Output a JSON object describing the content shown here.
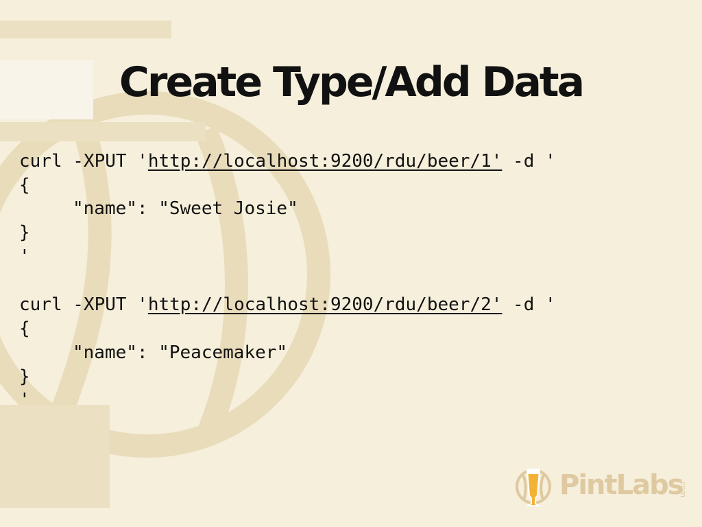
{
  "slide": {
    "title": "Create Type/Add Data",
    "code_blocks": [
      {
        "line1_prefix": "curl -XPUT '",
        "url": "http://localhost:9200/rdu/beer/1'",
        "line1_suffix": " -d '",
        "open_brace": "{",
        "body_line": "\"name\": \"Sweet Josie\"",
        "close_brace": "}",
        "close_quote": "'"
      },
      {
        "line1_prefix": "curl -XPUT '",
        "url": "http://localhost:9200/rdu/beer/2'",
        "line1_suffix": " -d '",
        "open_brace": "{",
        "body_line": "\"name\": \"Peacemaker\"",
        "close_brace": "}",
        "close_quote": "'"
      }
    ]
  },
  "brand": {
    "name": "PintLabs",
    "tld": ".com",
    "icon": "beer-glass-logo-icon"
  },
  "colors": {
    "background": "#f5efdb",
    "watermark": "#e9dcbb",
    "text": "#111111",
    "brand": "#dfc9a1",
    "brand_glass": "#f2b233"
  }
}
